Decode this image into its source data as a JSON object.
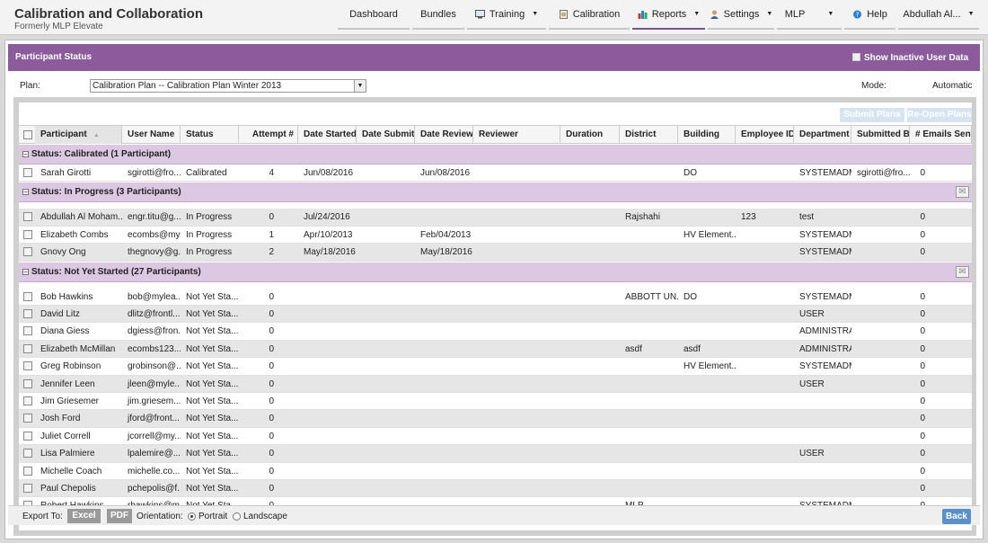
{
  "brand": {
    "title": "Calibration and Collaboration",
    "subtitle": "Formerly MLP Elevate"
  },
  "nav": {
    "dashboard": "Dashboard",
    "bundles": "Bundles",
    "training": "Training",
    "calibration": "Calibration",
    "reports": "Reports",
    "settings": "Settings",
    "mlp": "MLP",
    "help": "Help",
    "user": "Abdullah Al..."
  },
  "panel": {
    "title": "Participant Status",
    "show_inactive": "Show Inactive User Data"
  },
  "plan": {
    "label": "Plan:",
    "value": "Calibration Plan -- Calibration Plan Winter 2013",
    "mode_label": "Mode:",
    "mode_value": "Automatic"
  },
  "toolbar": {
    "submit": "Submit Plans",
    "reopen": "Re-Open Plans"
  },
  "columns": [
    "Participant",
    "User Name",
    "Status",
    "Attempt #",
    "Date Started",
    "Date Submitted",
    "Date Reviewed",
    "Reviewer",
    "Duration",
    "District",
    "Building",
    "Employee ID",
    "Department",
    "Submitted By",
    "# Emails Sent"
  ],
  "groups": [
    {
      "title": "Status: Calibrated (1 Participant)",
      "rows": [
        [
          "Sarah Girotti",
          "sgirotti@fro...",
          "Calibrated",
          "4",
          "Jun/08/2016",
          "",
          "Jun/08/2016",
          "",
          "",
          "",
          "DO",
          "",
          "SYSTEMADM...",
          "sgirotti@fro...",
          "0"
        ]
      ]
    },
    {
      "title": "Status: In Progress (3 Participants)",
      "rows": [
        [
          "Abdullah Al Moham...",
          "engr.titu@g...",
          "In Progress",
          "0",
          "Jul/24/2016",
          "",
          "",
          "",
          "",
          "Rajshahi",
          "",
          "123",
          "test",
          "",
          "0"
        ],
        [
          "Elizabeth Combs",
          "ecombs@my...",
          "In Progress",
          "1",
          "Apr/10/2013",
          "",
          "Feb/04/2013",
          "",
          "",
          "",
          "HV Element...",
          "",
          "SYSTEMADM...",
          "",
          "0"
        ],
        [
          "Gnovy Ong",
          "thegnovy@g...",
          "In Progress",
          "2",
          "May/18/2016",
          "",
          "May/18/2016",
          "",
          "",
          "",
          "",
          "",
          "SYSTEMADM...",
          "",
          "0"
        ]
      ]
    },
    {
      "title": "Status: Not Yet Started (27 Participants)",
      "rows": [
        [
          "Bob Hawkins",
          "bob@mylea...",
          "Not Yet Sta...",
          "0",
          "",
          "",
          "",
          "",
          "",
          "ABBOTT UN...",
          "DO",
          "",
          "SYSTEMADM...",
          "",
          "0"
        ],
        [
          "David Litz",
          "dlitz@frontl...",
          "Not Yet Sta...",
          "0",
          "",
          "",
          "",
          "",
          "",
          "",
          "",
          "",
          "USER",
          "",
          "0"
        ],
        [
          "Diana Giess",
          "dgiess@fron...",
          "Not Yet Sta...",
          "0",
          "",
          "",
          "",
          "",
          "",
          "",
          "",
          "",
          "ADMINISTRA...",
          "",
          "0"
        ],
        [
          "Elizabeth McMillan",
          "ecombs123...",
          "Not Yet Sta...",
          "0",
          "",
          "",
          "",
          "",
          "",
          "asdf",
          "asdf",
          "",
          "ADMINISTRA...",
          "",
          "0"
        ],
        [
          "Greg Robinson",
          "grobinson@...",
          "Not Yet Sta...",
          "0",
          "",
          "",
          "",
          "",
          "",
          "",
          "HV Element...",
          "",
          "SYSTEMADM...",
          "",
          "0"
        ],
        [
          "Jennifer Leen",
          "jleen@myle...",
          "Not Yet Sta...",
          "0",
          "",
          "",
          "",
          "",
          "",
          "",
          "",
          "",
          "USER",
          "",
          "0"
        ],
        [
          "Jim Griesemer",
          "jim.griesem...",
          "Not Yet Sta...",
          "0",
          "",
          "",
          "",
          "",
          "",
          "",
          "",
          "",
          "",
          "",
          "0"
        ],
        [
          "Josh Ford",
          "jford@front...",
          "Not Yet Sta...",
          "0",
          "",
          "",
          "",
          "",
          "",
          "",
          "",
          "",
          "",
          "",
          "0"
        ],
        [
          "Juliet Correll",
          "jcorrell@my...",
          "Not Yet Sta...",
          "0",
          "",
          "",
          "",
          "",
          "",
          "",
          "",
          "",
          "",
          "",
          "0"
        ],
        [
          "Lisa Palmiere",
          "lpalemire@...",
          "Not Yet Sta...",
          "0",
          "",
          "",
          "",
          "",
          "",
          "",
          "",
          "",
          "USER",
          "",
          "0"
        ],
        [
          "Michelle Coach",
          "michelle.co...",
          "Not Yet Sta...",
          "0",
          "",
          "",
          "",
          "",
          "",
          "",
          "",
          "",
          "",
          "",
          "0"
        ],
        [
          "Paul Chepolis",
          "pchepolis@f...",
          "Not Yet Sta...",
          "0",
          "",
          "",
          "",
          "",
          "",
          "",
          "",
          "",
          "",
          "",
          "0"
        ],
        [
          "Robert Hawkins",
          "rhawkins@m...",
          "Not Yet Sta...",
          "0",
          "",
          "",
          "",
          "",
          "",
          "MLP",
          "",
          "",
          "SYSTEMADM...",
          "",
          "0"
        ]
      ]
    }
  ],
  "footer": {
    "export": "Export To:",
    "excel": "Excel",
    "pdf": "PDF",
    "orientation": "Orientation:",
    "portrait": "Portrait",
    "landscape": "Landscape",
    "back": "Back"
  }
}
